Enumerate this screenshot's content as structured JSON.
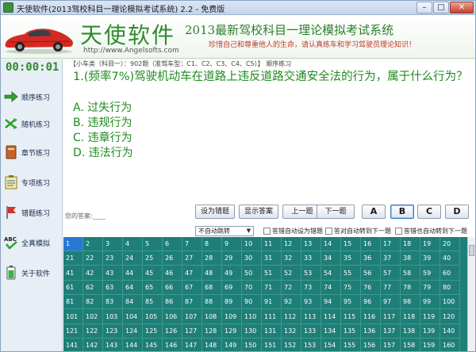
{
  "window": {
    "title": "天使软件(2013驾校科目一理论模拟考试系统) 2.2 - 免费版",
    "controls": {
      "minimize": "–",
      "maximize": "□",
      "close": "✕"
    }
  },
  "header": {
    "brand": "天使软件",
    "url": "http://www.Angelsofts.com",
    "title": "2013最新驾校科目一理论模拟考试系统",
    "motto": "珍惜自己和尊重他人的生命，请认真练车和学习驾驶员理论知识！"
  },
  "sidebar": {
    "timer": "00:00:01",
    "items": [
      {
        "label": "顺序练习",
        "icon": "arrow-right-icon"
      },
      {
        "label": "随机练习",
        "icon": "shuffle-icon"
      },
      {
        "label": "章节练习",
        "icon": "book-icon"
      },
      {
        "label": "专项练习",
        "icon": "checklist-icon"
      },
      {
        "label": "错题练习",
        "icon": "flag-icon"
      },
      {
        "label": "全真模拟",
        "icon": "abc-check-icon"
      },
      {
        "label": "关于软件",
        "icon": "battery-icon"
      }
    ]
  },
  "question": {
    "meta": "【小车类（科目一）：902题（准驾车型：C1、C2、C3、C4、C5）】 顺序练习",
    "text": "1.(频率7%)驾驶机动车在道路上违反道路交通安全法的行为，属于什么行为？",
    "options": [
      "A. 过失行为",
      "B. 违规行为",
      "C. 违章行为",
      "D. 违法行为"
    ],
    "answer_label": "您的答案:____"
  },
  "buttons": {
    "mark_wrong": "设为错题",
    "show_answer": "显示答案",
    "prev": "上一题",
    "next": "下一题",
    "answers": [
      "A",
      "B",
      "C",
      "D"
    ],
    "selected_answer": "B"
  },
  "settings": {
    "jump_select": "不自动跳转",
    "chk_auto_mark": "答错自动设为错题",
    "chk_right_next": "答对自动转到下一题",
    "chk_wrong_next": "答错也自动转到下一题"
  },
  "grid": {
    "total_visible": 160,
    "columns": 20,
    "current": 1
  },
  "colors": {
    "accent_green": "#2e8b2e",
    "grid_bg": "#1f7f78",
    "grid_active": "#2a78d6",
    "motto_red": "#c0392b"
  }
}
